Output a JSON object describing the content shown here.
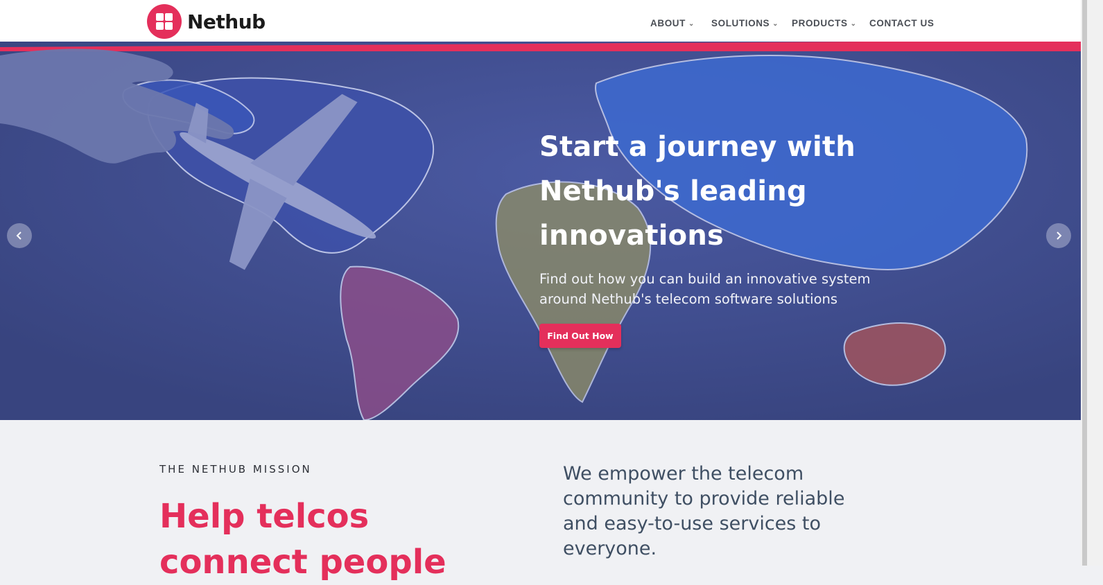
{
  "brand": {
    "name": "Nethub",
    "accent_color": "#e42f5b",
    "hero_overlay_color": "#3e4b8f"
  },
  "nav": {
    "items": [
      {
        "label": "ABOUT",
        "has_dropdown": true
      },
      {
        "label": "SOLUTIONS",
        "has_dropdown": true
      },
      {
        "label": "PRODUCTS",
        "has_dropdown": true
      },
      {
        "label": "CONTACT US",
        "has_dropdown": false
      }
    ],
    "caret_icon": "chevron-down-icon"
  },
  "hero": {
    "title_lines": [
      "Start a journey with",
      "Nethub's leading",
      "innovations"
    ],
    "subtitle_lines": [
      "Find out how you can build an innovative system",
      "around Nethub's telecom software solutions"
    ],
    "cta_label": "Find Out How",
    "prev_icon": "chevron-left-icon",
    "next_icon": "chevron-right-icon"
  },
  "mission": {
    "eyebrow": "THE NETHUB MISSION",
    "title_lines": [
      "Help telcos",
      "connect people"
    ],
    "text_lines": [
      "We empower the telecom",
      "community to provide reliable",
      "and easy-to-use services to",
      "everyone."
    ]
  }
}
